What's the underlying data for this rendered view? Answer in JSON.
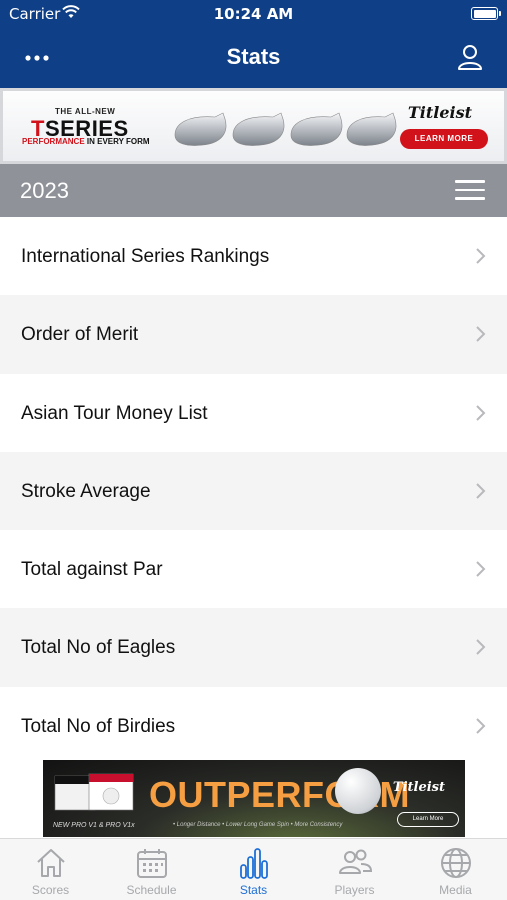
{
  "status_bar": {
    "carrier": "Carrier",
    "time": "10:24 AM"
  },
  "header": {
    "title": "Stats",
    "bg_color": "#0f3f86"
  },
  "top_ad": {
    "eyebrow": "THE ALL-NEW",
    "product_prefix": "T",
    "product_suffix": "SERIES",
    "tagline_red": "PERFORMANCE",
    "tagline_rest": " IN EVERY FORM",
    "brand": "Titleist",
    "cta": "LEARN MORE"
  },
  "season": {
    "year": "2023"
  },
  "stats_list": [
    {
      "label": "International Series Rankings"
    },
    {
      "label": "Order of Merit"
    },
    {
      "label": "Asian Tour Money List"
    },
    {
      "label": "Stroke Average"
    },
    {
      "label": "Total against Par"
    },
    {
      "label": "Total No of Eagles"
    },
    {
      "label": "Total No of Birdies"
    }
  ],
  "bottom_ad": {
    "headline": "OUTPERFORM",
    "brand": "Titleist",
    "product_line": "NEW PRO V1 & PRO V1x",
    "bullets": "• Longer Distance  • Lower Long Game Spin  • More Consistency",
    "cta": "Learn More"
  },
  "tab_bar": {
    "tabs": [
      {
        "label": "Scores",
        "icon": "home-icon"
      },
      {
        "label": "Schedule",
        "icon": "calendar-icon"
      },
      {
        "label": "Stats",
        "icon": "bar-chart-icon",
        "active": true
      },
      {
        "label": "Players",
        "icon": "players-icon"
      },
      {
        "label": "Media",
        "icon": "globe-icon"
      }
    ],
    "active_color": "#1f6fd6",
    "inactive_color": "#a6a8ab"
  }
}
